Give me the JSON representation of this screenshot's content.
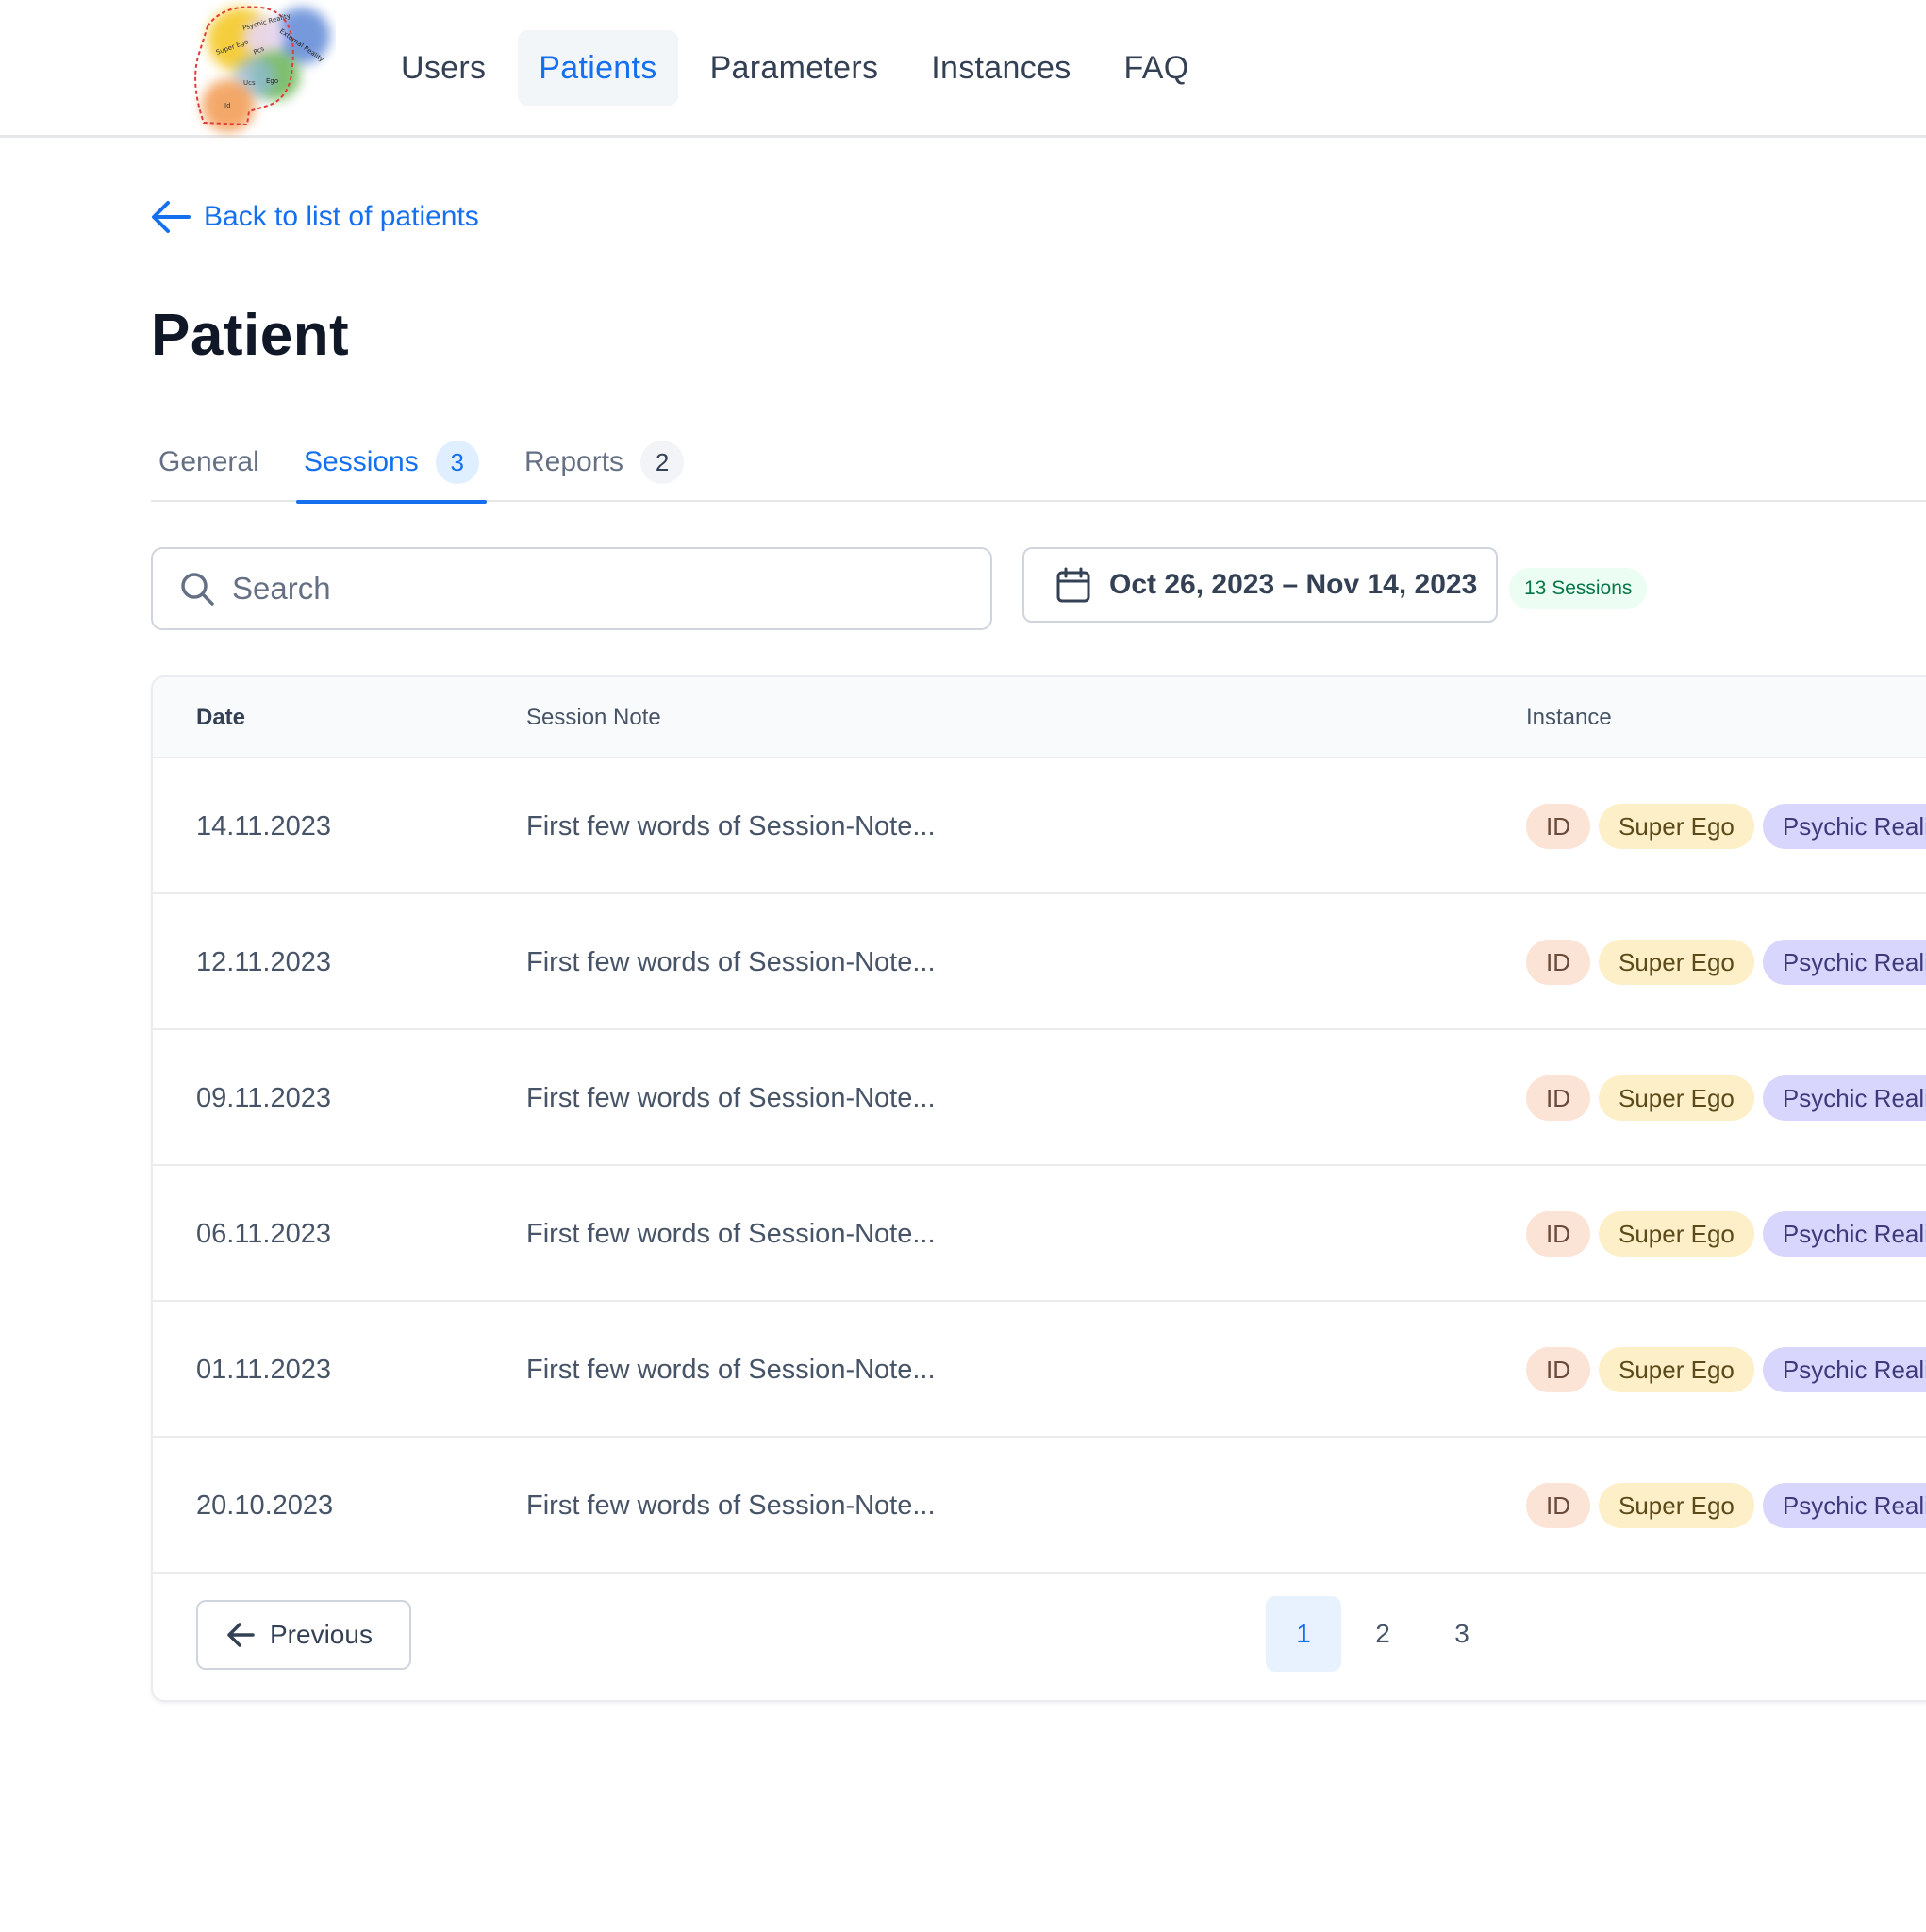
{
  "nav": {
    "items": [
      {
        "label": "Users",
        "active": false
      },
      {
        "label": "Patients",
        "active": true
      },
      {
        "label": "Parameters",
        "active": false
      },
      {
        "label": "Instances",
        "active": false
      },
      {
        "label": "FAQ",
        "active": false
      }
    ]
  },
  "logo": {
    "labels": [
      "Super Ego",
      "Psychic Reality",
      "External Reality",
      "Ego",
      "Ucs",
      "Pcs",
      "Id"
    ]
  },
  "back_link": {
    "label": "Back to list of patients",
    "icon": "arrow-left-icon"
  },
  "page_title": "Patient",
  "tabs": [
    {
      "label": "General",
      "count": null,
      "active": false
    },
    {
      "label": "Sessions",
      "count": "3",
      "active": true
    },
    {
      "label": "Reports",
      "count": "2",
      "active": false
    }
  ],
  "search": {
    "placeholder": "Search",
    "value": "",
    "icon": "search-icon"
  },
  "date_range": {
    "label": "Oct 26, 2023 – Nov 14, 2023",
    "icon": "calendar-icon"
  },
  "sessions_count": "13 Sessions",
  "table": {
    "columns": {
      "date": "Date",
      "note": "Session Note",
      "instance": "Instance"
    },
    "rows": [
      {
        "date": "14.11.2023",
        "note": "First few words of Session-Note...",
        "tags": [
          "ID",
          "Super Ego",
          "Psychic Reality"
        ]
      },
      {
        "date": "12.11.2023",
        "note": "First few words of Session-Note...",
        "tags": [
          "ID",
          "Super Ego",
          "Psychic Reality"
        ]
      },
      {
        "date": "09.11.2023",
        "note": "First few words of Session-Note...",
        "tags": [
          "ID",
          "Super Ego",
          "Psychic Reality"
        ]
      },
      {
        "date": "06.11.2023",
        "note": "First few words of Session-Note...",
        "tags": [
          "ID",
          "Super Ego",
          "Psychic Reality"
        ]
      },
      {
        "date": "01.11.2023",
        "note": "First few words of Session-Note...",
        "tags": [
          "ID",
          "Super Ego",
          "Psychic Reality"
        ]
      },
      {
        "date": "20.10.2023",
        "note": "First few words of Session-Note...",
        "tags": [
          "ID",
          "Super Ego",
          "Psychic Reality"
        ]
      }
    ]
  },
  "tag_colors": {
    "ID": {
      "bg": "#fbe3d6",
      "fg": "#6b4a3a"
    },
    "Super Ego": {
      "bg": "#fdf0c8",
      "fg": "#5c4a1a"
    },
    "Psychic Reality": {
      "bg": "#d9d6fe",
      "fg": "#3e3a7a"
    }
  },
  "pagination": {
    "previous_label": "Previous",
    "pages": [
      "1",
      "2",
      "3"
    ],
    "current": "1"
  },
  "colors": {
    "accent": "#1570ef",
    "border": "#d0d5dd"
  }
}
